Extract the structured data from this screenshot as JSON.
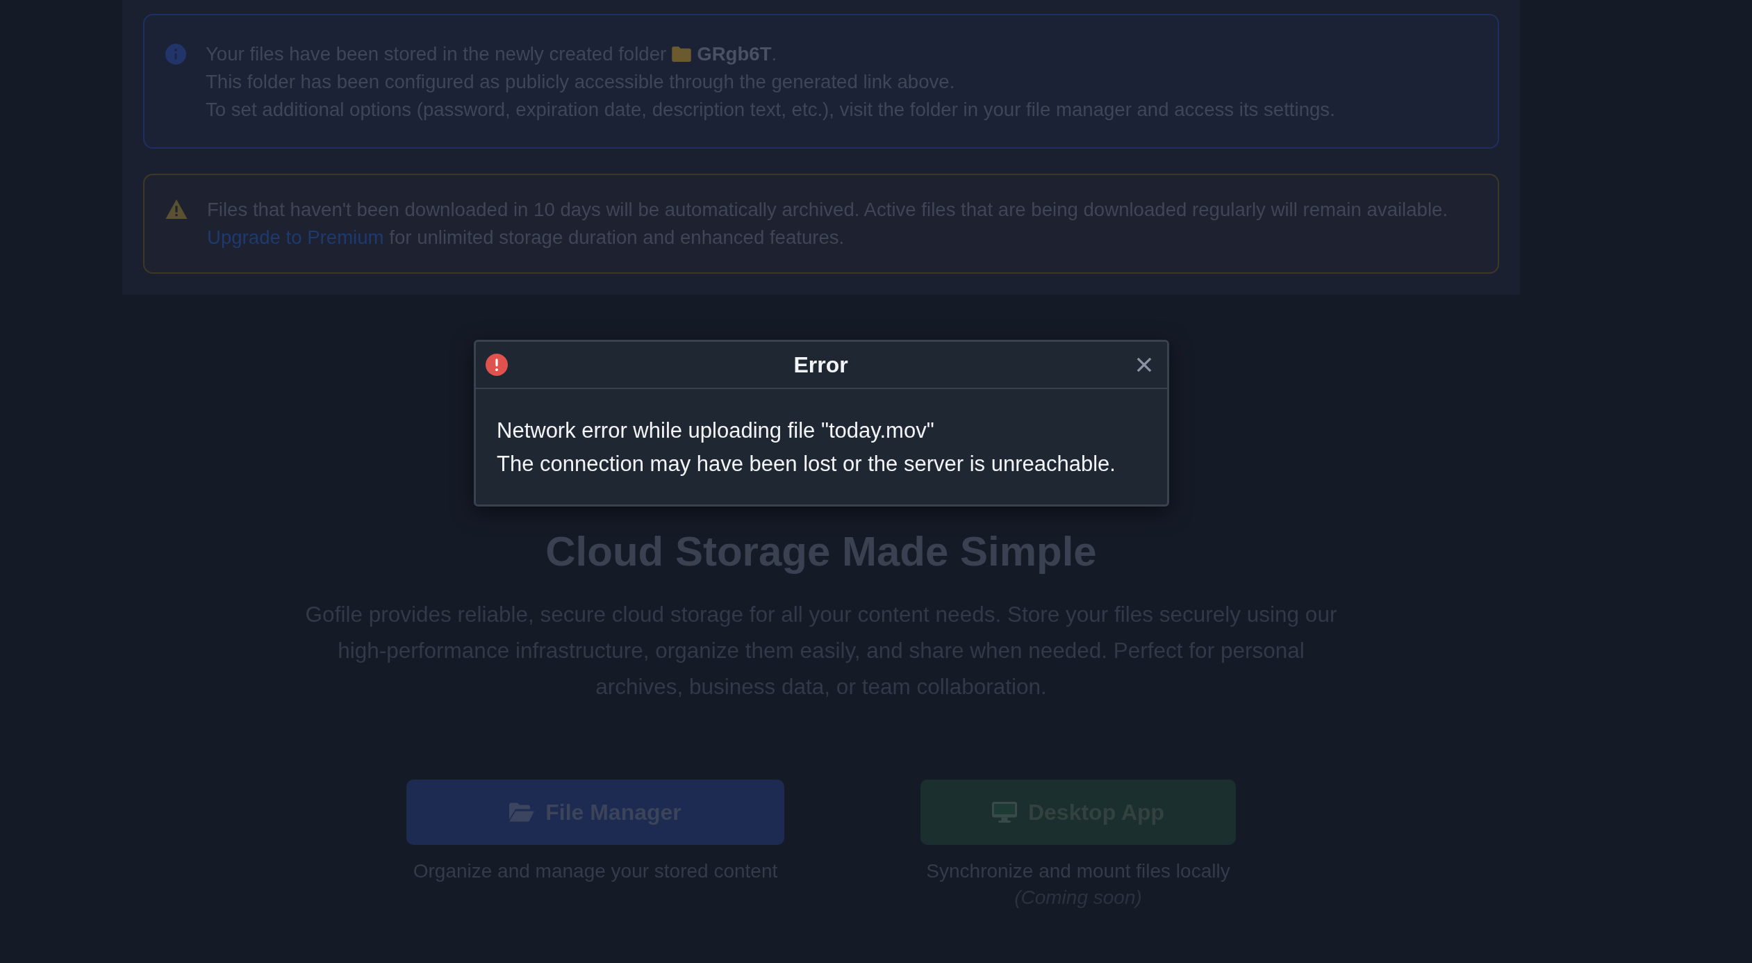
{
  "notices": [
    {
      "kind": "info",
      "lines": [
        "Your files have been stored in the newly created folder",
        "This folder has been configured as publicly accessible through the generated link above.",
        "To set additional options (password, expiration date, description text, etc.), visit the folder in your file manager and access its settings."
      ],
      "folder": "**GRgb6T**."
    },
    {
      "kind": "warning",
      "text_before": "Files that haven't been downloaded in 10 days will be automatically archived. Active files that are being downloaded regularly will remain available.",
      "link": "Upgrade to Premium",
      "text_after": "for unlimited storage duration and enhanced features."
    }
  ],
  "hero": {
    "title": "Cloud Storage Made Simple",
    "description": "Gofile provides reliable, secure cloud storage for all your content needs. Store your files securely using our high-performance infrastructure, organize them easily, and share when needed. Perfect for personal archives, business data, or team collaboration."
  },
  "actions": [
    {
      "kind": "file_manager",
      "label": "File Manager",
      "caption": "Organize and manage your stored content"
    },
    {
      "kind": "desktop",
      "label": "Desktop App",
      "caption": "Synchronize and mount files locally",
      "note": "(Coming soon)"
    }
  ],
  "dialog": {
    "title": "Error",
    "lines": [
      "Network error while uploading file \"today.mov\"",
      "The connection may have been lost or the server is unreachable."
    ]
  }
}
